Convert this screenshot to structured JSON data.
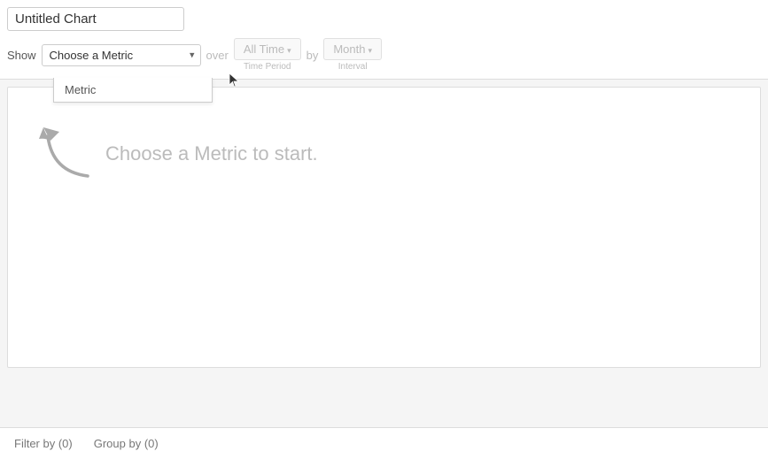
{
  "header": {
    "title_placeholder": "Untitled Chart",
    "title_value": "Untitled Chart"
  },
  "controls": {
    "show_label": "Show",
    "metric_placeholder": "Choose a Metric",
    "over_label": "over",
    "time_period_label": "All Time",
    "time_period_sub": "Time Period",
    "by_label": "by",
    "interval_label": "Month",
    "interval_sub": "Interval",
    "metric_hint": "Metric"
  },
  "chart": {
    "empty_message": "Choose a Metric to start."
  },
  "footer": {
    "filter_label": "Filter by (0)",
    "group_label": "Group by (0)"
  }
}
